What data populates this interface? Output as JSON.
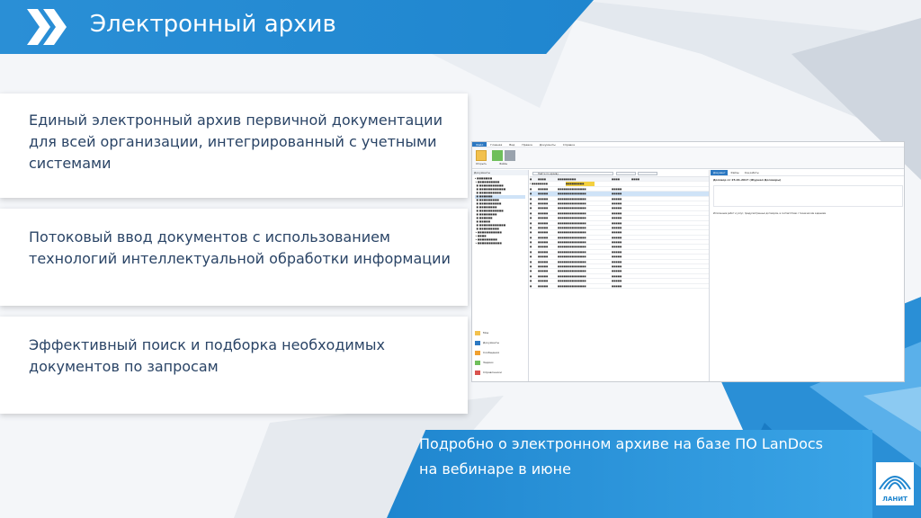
{
  "header": {
    "title": "Электронный архив"
  },
  "features": [
    {
      "text": "Единый электронный архив первичной документации для всей организации, интегрированный с учетными системами"
    },
    {
      "text": "Потоковый ввод документов с использованием технологий интеллектуальной обработки информации"
    },
    {
      "text": "Эффективный поиск и подборка необходимых документов по запросам"
    }
  ],
  "footer": {
    "line1": "Подробно о электронном архиве на базе ПО LanDocs",
    "line2": "на вебинаре в июне",
    "logo_text": "ЛАНИТ"
  },
  "app": {
    "ribbon_tabs": [
      "Файл",
      "Главная",
      "Вид",
      "Правка",
      "Документы",
      "Справка"
    ],
    "ribbon_groups": [
      "Открыть",
      "Файлы"
    ],
    "tree_title": "Документы",
    "nav": [
      "Мое",
      "Документы",
      "Сообщения",
      "Задачи",
      "Справочники"
    ],
    "search_placeholder": "Найти по архиву",
    "preview_title": "Договор от 25.01.2017 (Журнал Договоры)",
    "preview_tabs": [
      "Документ",
      "Файлы",
      "Ход работы"
    ],
    "preview_text": "Исполнение работ и услуг, предусмотренных договором, в соответствии с техническим заданием"
  },
  "colors": {
    "accent": "#1f86cf",
    "text": "#2a4466"
  }
}
